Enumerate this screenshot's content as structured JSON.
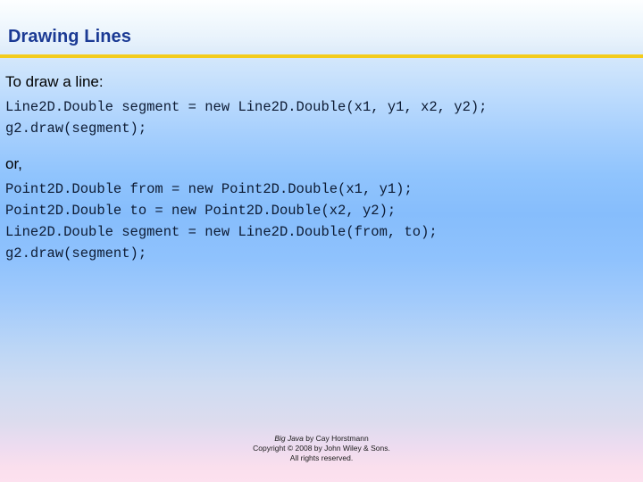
{
  "slide": {
    "title": "Drawing Lines",
    "accent_color": "#f3cc1c",
    "title_color": "#1b3a94",
    "body_color": "#000000",
    "code_color": "#0d1b33",
    "background": {
      "top_color": "#fdfeff",
      "mid_color": "#86bdfc",
      "bottom_color": "#fde1ef"
    }
  },
  "content": {
    "lead_1": "To draw a line:",
    "code_1": [
      "Line2D.Double segment = new Line2D.Double(x1, y1, x2, y2);",
      "g2.draw(segment);"
    ],
    "lead_2": "or,",
    "code_2": [
      "Point2D.Double from = new Point2D.Double(x1, y1);",
      "Point2D.Double to = new Point2D.Double(x2, y2);",
      "Line2D.Double segment = new Line2D.Double(from, to);",
      "g2.draw(segment);"
    ]
  },
  "footer": {
    "line1_book": "Big Java",
    "line1_rest": " by Cay Horstmann",
    "line2": "Copyright © 2008 by John Wiley & Sons.",
    "line3": "All rights reserved."
  }
}
